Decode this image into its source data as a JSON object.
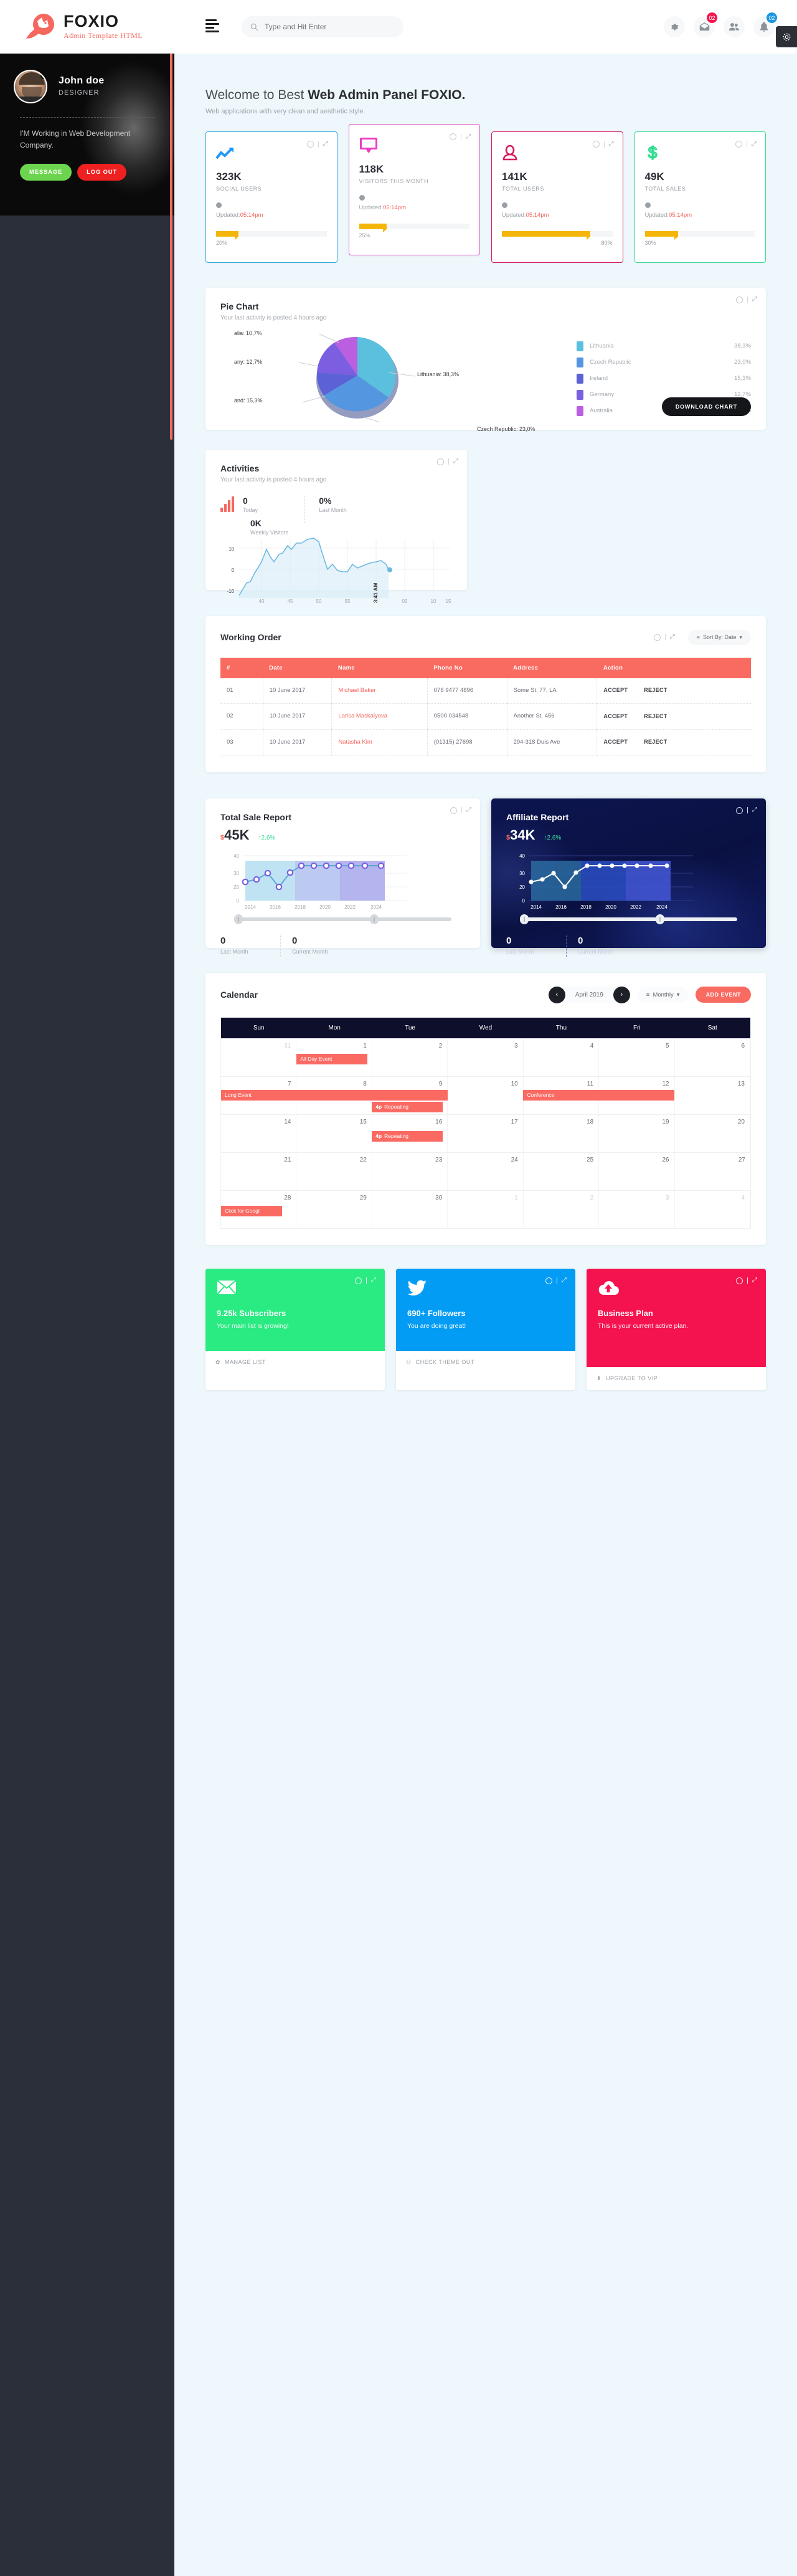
{
  "header": {
    "logo_title": "FOXIO",
    "logo_sub": "Admin Template HTML",
    "search_placeholder": "Type and Hit Enter",
    "icons": {
      "gear": "gear-icon",
      "mail": "mail-icon",
      "mail_badge": "02",
      "users": "users-icon",
      "bell": "bell-icon",
      "bell_badge": "02"
    }
  },
  "sidebar": {
    "profile": {
      "name": "John doe",
      "role": "DESIGNER",
      "description": "I'M Working in Web Development Company.",
      "message_label": "MESSAGE",
      "logout_label": "LOG OUT"
    }
  },
  "welcome": {
    "prefix": "Welcome to Best ",
    "strong": "Web Admin Panel FOXIO.",
    "subtitle": "Web applications with very clean and aesthetic style."
  },
  "stats": [
    {
      "icon": "trending-up-icon",
      "value": "323K",
      "label": "SOCIAL USERS",
      "updated_prefix": "Updated:",
      "updated_time": "05:14pm",
      "percent": 20,
      "percent_label": "20%",
      "accent": "#37a9e0"
    },
    {
      "icon": "monitor-icon",
      "value": "118K",
      "label": "VISITORS THIS MONTH",
      "updated_prefix": "Updated:",
      "updated_time": "05:14pm",
      "percent": 25,
      "percent_label": "25%",
      "accent": "#e857c9"
    },
    {
      "icon": "user-icon",
      "value": "141K",
      "label": "TOTAL USERS",
      "updated_prefix": "Updated:",
      "updated_time": "05:14pm",
      "percent": 80,
      "percent_label": "80%",
      "accent": "#d81b60"
    },
    {
      "icon": "dollar-icon",
      "value": "49K",
      "label": "TOTAL SALES",
      "updated_prefix": "Updated:",
      "updated_time": "05:14pm",
      "percent": 30,
      "percent_label": "30%",
      "accent": "#3ddc97"
    }
  ],
  "pie": {
    "title": "Pie Chart",
    "subtitle": "Your last activity is posted 4 hours ago",
    "download_label": "DOWNLOAD CHART",
    "callouts": [
      "alia: 10,7%",
      "any: 12,7%",
      "and: 15,3%",
      "Lithuania: 38,3%",
      "Czech Republic: 23,0%"
    ]
  },
  "activities": {
    "title": "Activities",
    "subtitle": "Your last activity is posted 4 hours ago",
    "today_value": "0",
    "today_label": "Today",
    "lastmonth_value": "0%",
    "lastmonth_label": "Last Month",
    "weekly_value": "0K",
    "weekly_label": "Weekly Visitors",
    "marker_label": "3:41 AM"
  },
  "working_order": {
    "title": "Working Order",
    "sort_label": "Sort By: Date",
    "columns": [
      "#",
      "Date",
      "Name",
      "Phone No",
      "Address",
      "Action"
    ],
    "rows": [
      {
        "no": "01",
        "date": "10 June 2017",
        "name": "Michael Baker",
        "phone": "076 9477 4896",
        "address": "Some St. 77, LA",
        "accept": "ACCEPT",
        "reject": "REJECT"
      },
      {
        "no": "02",
        "date": "10 June 2017",
        "name": "Larisa Maskalyova",
        "phone": "0500 034548",
        "address": "Another St. 456",
        "accept": "ACCEPT",
        "reject": "REJECT"
      },
      {
        "no": "03",
        "date": "10 June 2017",
        "name": "Natasha Kim",
        "phone": "(01315) 27698",
        "address": "294-318 Duis Ave",
        "accept": "ACCEPT",
        "reject": "REJECT"
      }
    ]
  },
  "total_sale": {
    "title": "Total Sale Report",
    "currency": "$",
    "amount": "45K",
    "delta": "↑2.6%",
    "last_value": "0",
    "last_label": "Last Month",
    "current_value": "0",
    "current_label": "Current Month"
  },
  "affiliate": {
    "title": "Affiliate Report",
    "currency": "$",
    "amount": "34K",
    "delta": "↑2.6%",
    "last_value": "0",
    "last_label": "Last Month",
    "current_value": "0",
    "current_label": "Current Month"
  },
  "calendar": {
    "title": "Calendar",
    "month_label": "April 2019",
    "prev": "‹",
    "next": "›",
    "view_label": "Monthly",
    "add_event_label": "ADD EVENT",
    "dow": [
      "Sun",
      "Mon",
      "Tue",
      "Wed",
      "Thu",
      "Fri",
      "Sat"
    ],
    "weeks": [
      [
        "31",
        "1",
        "2",
        "3",
        "4",
        "5",
        "6"
      ],
      [
        "7",
        "8",
        "9",
        "10",
        "11",
        "12",
        "13"
      ],
      [
        "14",
        "15",
        "16",
        "17",
        "18",
        "19",
        "20"
      ],
      [
        "21",
        "22",
        "23",
        "24",
        "25",
        "26",
        "27"
      ],
      [
        "28",
        "29",
        "30",
        "1",
        "2",
        "3",
        "4"
      ]
    ],
    "muted": [
      [
        0
      ],
      [],
      [],
      [],
      [
        3,
        4,
        5,
        6
      ]
    ],
    "events": [
      {
        "label": "All Day Event",
        "week": 0,
        "start": 1,
        "span": 1,
        "row": 0,
        "time": ""
      },
      {
        "label": "Long Event",
        "week": 1,
        "start": 0,
        "span": 3,
        "row": 0,
        "time": ""
      },
      {
        "label": "Conference",
        "week": 1,
        "start": 4,
        "span": 2,
        "row": 0,
        "time": ""
      },
      {
        "label": "Repeating",
        "week": 1,
        "start": 2,
        "span": 1,
        "row": 1,
        "time": "4p"
      },
      {
        "label": "Repeating",
        "week": 2,
        "start": 2,
        "span": 1,
        "row": 0,
        "time": "4p"
      },
      {
        "label": "Click for Googl",
        "week": 4,
        "start": 0,
        "span": 1,
        "row": 0,
        "time": ""
      }
    ]
  },
  "social_cards": [
    {
      "icon": "envelope-icon",
      "title": "9.25k Subscribers",
      "subtitle": "Your main list is growing!",
      "action": "MANAGE LIST",
      "action_icon": "gear-icon",
      "color": "#2aea82"
    },
    {
      "icon": "twitter-icon",
      "title": "690+ Followers",
      "subtitle": "You are doing great!",
      "action": "CHECK THEME OUT",
      "action_icon": "users-icon",
      "color": "#029cf5"
    },
    {
      "icon": "cloud-upload-icon",
      "title": "Business Plan",
      "subtitle": "This is your current active plan.",
      "action": "UPGRADE TO VIP",
      "action_icon": "arrow-up-icon",
      "color": "#f5134f"
    }
  ],
  "chart_data": [
    {
      "type": "pie",
      "title": "Pie Chart",
      "labels": [
        "Lithuania",
        "Czech Republic",
        "Ireland",
        "Germany",
        "Australia"
      ],
      "values": [
        38.3,
        23.0,
        15.3,
        12.7,
        10.7
      ],
      "value_labels": [
        "38,3%",
        "23,0%",
        "15,3%",
        "12,7%",
        "10,7%"
      ],
      "colors": [
        "#5bc0de",
        "#5596e0",
        "#5c62d6",
        "#7b5fe0",
        "#b95fe0"
      ],
      "legend": "right"
    },
    {
      "type": "area",
      "title": "Activities",
      "xlabel": "",
      "ylabel": "",
      "ylim": [
        -20,
        20
      ],
      "yticks": [
        -10,
        0,
        10
      ],
      "xticks": [
        "40",
        "45",
        "50",
        "55",
        "3:41 AM",
        "05",
        "10",
        "15"
      ],
      "values": [
        -18,
        -14,
        -10,
        -9,
        -4,
        1,
        6,
        12,
        8,
        5,
        9,
        10,
        14,
        12,
        16,
        17,
        17,
        20,
        19,
        11,
        3,
        6,
        1,
        -1,
        -1,
        4,
        2,
        3,
        4,
        5,
        6,
        5,
        1
      ],
      "grid": true,
      "color": "#6db9e0"
    },
    {
      "type": "line",
      "title": "Total Sale Report",
      "xlabel": "",
      "ylabel": "",
      "ylim": [
        0,
        45
      ],
      "yticks": [
        0,
        10,
        20,
        30,
        40
      ],
      "categories": [
        "2014",
        "2016",
        "2018",
        "2020",
        "2022",
        "2024"
      ],
      "values": [
        23,
        26,
        30,
        20,
        30,
        34,
        34,
        34,
        34,
        34,
        34
      ],
      "color": "#7b5fe0",
      "grid": true
    },
    {
      "type": "line",
      "title": "Affiliate Report",
      "xlabel": "",
      "ylabel": "",
      "ylim": [
        0,
        45
      ],
      "yticks": [
        0,
        10,
        20,
        30,
        40
      ],
      "categories": [
        "2014",
        "2016",
        "2018",
        "2020",
        "2022",
        "2024"
      ],
      "values": [
        23,
        26,
        30,
        20,
        30,
        34,
        34,
        34,
        34,
        34,
        34
      ],
      "color": "#ffffff",
      "grid": true
    }
  ]
}
